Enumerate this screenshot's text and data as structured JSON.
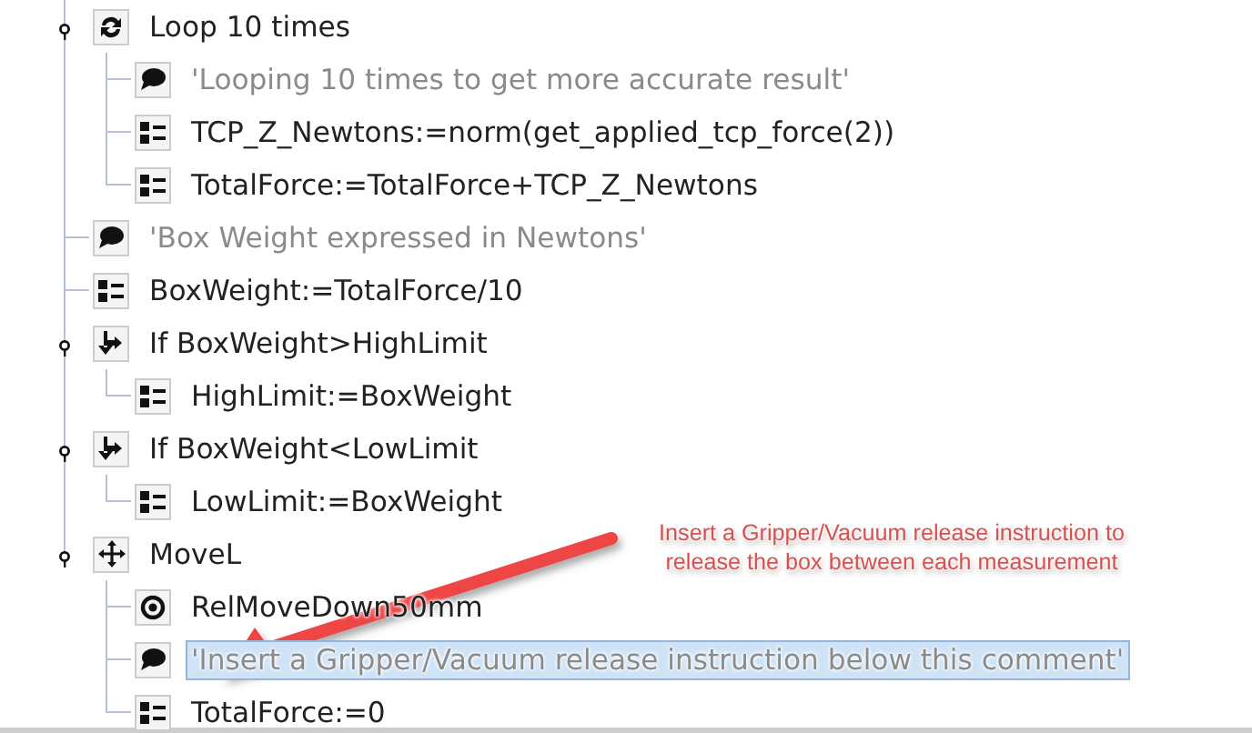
{
  "program_tree": [
    {
      "kind": "loop",
      "label": "Loop 10 times",
      "expanded": true,
      "children": [
        {
          "kind": "comment",
          "label": "'Looping 10 times to get more accurate result'"
        },
        {
          "kind": "assignment",
          "label": "TCP_Z_Newtons:=norm(get_applied_tcp_force(2))"
        },
        {
          "kind": "assignment",
          "label": "TotalForce:=TotalForce+TCP_Z_Newtons"
        }
      ]
    },
    {
      "kind": "comment",
      "label": "'Box Weight expressed in Newtons'"
    },
    {
      "kind": "assignment",
      "label": "BoxWeight:=TotalForce/10"
    },
    {
      "kind": "if",
      "label": "If BoxWeight>HighLimit",
      "expanded": true,
      "children": [
        {
          "kind": "assignment",
          "label": "HighLimit:=BoxWeight"
        }
      ]
    },
    {
      "kind": "if",
      "label": "If BoxWeight<LowLimit",
      "expanded": true,
      "children": [
        {
          "kind": "assignment",
          "label": "LowLimit:=BoxWeight"
        }
      ]
    },
    {
      "kind": "move",
      "label": "MoveL",
      "expanded": true,
      "children": [
        {
          "kind": "waypoint",
          "label": "RelMoveDown50mm"
        },
        {
          "kind": "comment",
          "label": "'Insert a Gripper/Vacuum release instruction below this comment'",
          "selected": true
        },
        {
          "kind": "assignment",
          "label": "TotalForce:=0"
        }
      ]
    }
  ],
  "annotation": {
    "text": "Insert a Gripper/Vacuum release instruction to release the box between each measurement"
  }
}
